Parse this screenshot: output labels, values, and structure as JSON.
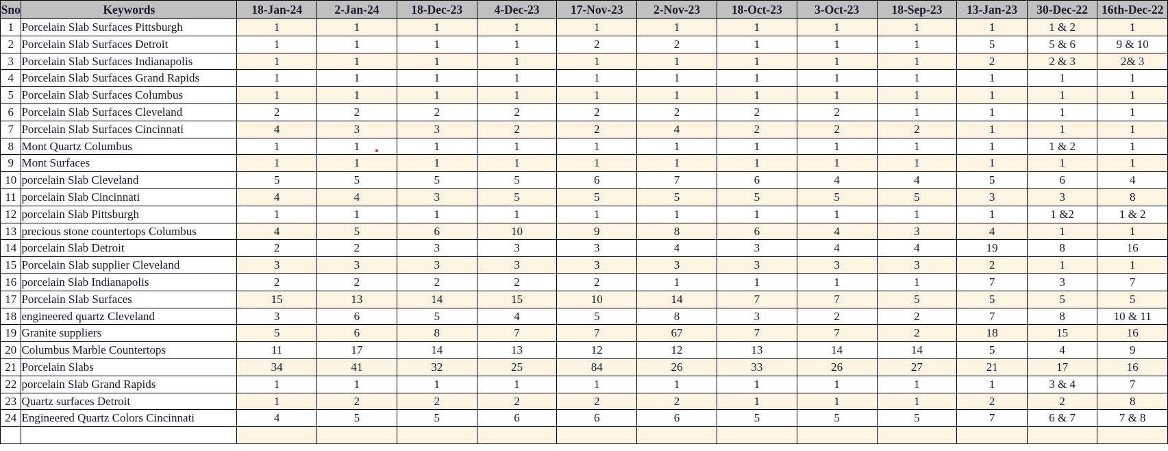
{
  "table": {
    "columns": [
      "Sno",
      "Keywords",
      "18-Jan-24",
      "2-Jan-24",
      "18-Dec-23",
      "4-Dec-23",
      "17-Nov-23",
      "2-Nov-23",
      "18-Oct-23",
      "3-Oct-23",
      "18-Sep-23",
      "13-Jan-23",
      "30-Dec-22",
      "16th-Dec-22"
    ],
    "rows": [
      {
        "sno": "1",
        "keyword": "Porcelain Slab Surfaces Pittsburgh",
        "values": [
          "1",
          "1",
          "1",
          "1",
          "1",
          "1",
          "1",
          "1",
          "1",
          "1",
          "1 & 2",
          "1"
        ]
      },
      {
        "sno": "2",
        "keyword": "Porcelain Slab Surfaces Detroit",
        "values": [
          "1",
          "1",
          "1",
          "1",
          "2",
          "2",
          "1",
          "1",
          "1",
          "5",
          "5 & 6",
          "9 & 10"
        ]
      },
      {
        "sno": "3",
        "keyword": "Porcelain Slab Surfaces Indianapolis",
        "values": [
          "1",
          "1",
          "1",
          "1",
          "1",
          "1",
          "1",
          "1",
          "1",
          "2",
          "2 & 3",
          "2& 3"
        ]
      },
      {
        "sno": "4",
        "keyword": "Porcelain Slab Surfaces Grand Rapids",
        "values": [
          "1",
          "1",
          "1",
          "1",
          "1",
          "1",
          "1",
          "1",
          "1",
          "1",
          "1",
          "1"
        ]
      },
      {
        "sno": "5",
        "keyword": "Porcelain Slab Surfaces Columbus",
        "values": [
          "1",
          "1",
          "1",
          "1",
          "1",
          "1",
          "1",
          "1",
          "1",
          "1",
          "1",
          "1"
        ]
      },
      {
        "sno": "6",
        "keyword": "Porcelain Slab Surfaces Cleveland",
        "values": [
          "2",
          "2",
          "2",
          "2",
          "2",
          "2",
          "2",
          "2",
          "1",
          "1",
          "1",
          "1"
        ]
      },
      {
        "sno": "7",
        "keyword": "Porcelain Slab Surfaces Cincinnati",
        "values": [
          "4",
          "3",
          "3",
          "2",
          "2",
          "4",
          "2",
          "2",
          "2",
          "1",
          "1",
          "1"
        ]
      },
      {
        "sno": "8",
        "keyword": "Mont Quartz Columbus",
        "values": [
          "1",
          "1",
          "1",
          "1",
          "1",
          "1",
          "1",
          "1",
          "1",
          "1",
          "1 & 2",
          "1"
        ]
      },
      {
        "sno": "9",
        "keyword": "Mont Surfaces",
        "values": [
          "1",
          "1",
          "1",
          "1",
          "1",
          "1",
          "1",
          "1",
          "1",
          "1",
          "1",
          "1"
        ]
      },
      {
        "sno": "10",
        "keyword": "porcelain Slab Cleveland",
        "values": [
          "5",
          "5",
          "5",
          "5",
          "6",
          "7",
          "6",
          "4",
          "4",
          "5",
          "6",
          "4"
        ]
      },
      {
        "sno": "11",
        "keyword": "porcelain Slab Cincinnati",
        "values": [
          "4",
          "4",
          "3",
          "5",
          "5",
          "5",
          "5",
          "5",
          "5",
          "3",
          "3",
          "8"
        ]
      },
      {
        "sno": "12",
        "keyword": "porcelain Slab Pittsburgh",
        "values": [
          "1",
          "1",
          "1",
          "1",
          "1",
          "1",
          "1",
          "1",
          "1",
          "1",
          "1 &2",
          "1 & 2"
        ]
      },
      {
        "sno": "13",
        "keyword": "precious stone countertops Columbus",
        "values": [
          "4",
          "5",
          "6",
          "10",
          "9",
          "8",
          "6",
          "4",
          "3",
          "4",
          "1",
          "1"
        ]
      },
      {
        "sno": "14",
        "keyword": "porcelain Slab Detroit",
        "values": [
          "2",
          "2",
          "3",
          "3",
          "3",
          "4",
          "3",
          "4",
          "4",
          "19",
          "8",
          "16"
        ]
      },
      {
        "sno": "15",
        "keyword": "Porcelain Slab supplier Cleveland",
        "values": [
          "3",
          "3",
          "3",
          "3",
          "3",
          "3",
          "3",
          "3",
          "3",
          "2",
          "1",
          "1"
        ]
      },
      {
        "sno": "16",
        "keyword": "porcelain Slab Indianapolis",
        "values": [
          "2",
          "2",
          "2",
          "2",
          "2",
          "1",
          "1",
          "1",
          "1",
          "7",
          "3",
          "7"
        ]
      },
      {
        "sno": "17",
        "keyword": "Porcelain Slab Surfaces",
        "values": [
          "15",
          "13",
          "14",
          "15",
          "10",
          "14",
          "7",
          "7",
          "5",
          "5",
          "5",
          "5"
        ]
      },
      {
        "sno": "18",
        "keyword": "engineered quartz Cleveland",
        "values": [
          "3",
          "6",
          "5",
          "4",
          "5",
          "8",
          "3",
          "2",
          "2",
          "7",
          "8",
          "10 & 11"
        ]
      },
      {
        "sno": "19",
        "keyword": "Granite suppliers",
        "values": [
          "5",
          "6",
          "8",
          "7",
          "7",
          "67",
          "7",
          "7",
          "2",
          "18",
          "15",
          "16"
        ]
      },
      {
        "sno": "20",
        "keyword": "Columbus Marble Countertops",
        "values": [
          "11",
          "17",
          "14",
          "13",
          "12",
          "12",
          "13",
          "14",
          "14",
          "5",
          "4",
          "9"
        ]
      },
      {
        "sno": "21",
        "keyword": "Porcelain Slabs",
        "values": [
          "34",
          "41",
          "32",
          "25",
          "84",
          "26",
          "33",
          "26",
          "27",
          "21",
          "17",
          "16"
        ]
      },
      {
        "sno": "22",
        "keyword": "porcelain Slab Grand Rapids",
        "values": [
          "1",
          "1",
          "1",
          "1",
          "1",
          "1",
          "1",
          "1",
          "1",
          "1",
          "3 & 4",
          "7"
        ]
      },
      {
        "sno": "23",
        "keyword": "Quartz surfaces Detroit",
        "values": [
          "1",
          "2",
          "2",
          "2",
          "2",
          "2",
          "1",
          "1",
          "1",
          "2",
          "2",
          "8"
        ]
      },
      {
        "sno": "24",
        "keyword": "Engineered Quartz Colors Cincinnati",
        "values": [
          "4",
          "5",
          "5",
          "6",
          "6",
          "6",
          "5",
          "5",
          "5",
          "7",
          "6 & 7",
          "7 & 8"
        ]
      },
      {
        "sno": "",
        "keyword": "",
        "values": [
          "",
          "",
          "",
          "",
          "",
          "",
          "",
          "",
          "",
          "",
          "",
          ""
        ]
      }
    ]
  },
  "colors": {
    "header_background": "#c0c0c0",
    "row_tint": "#fdf5e1",
    "row_plain": "#ffffff",
    "grid_line": "#000000",
    "text": "#1a1a2e"
  }
}
